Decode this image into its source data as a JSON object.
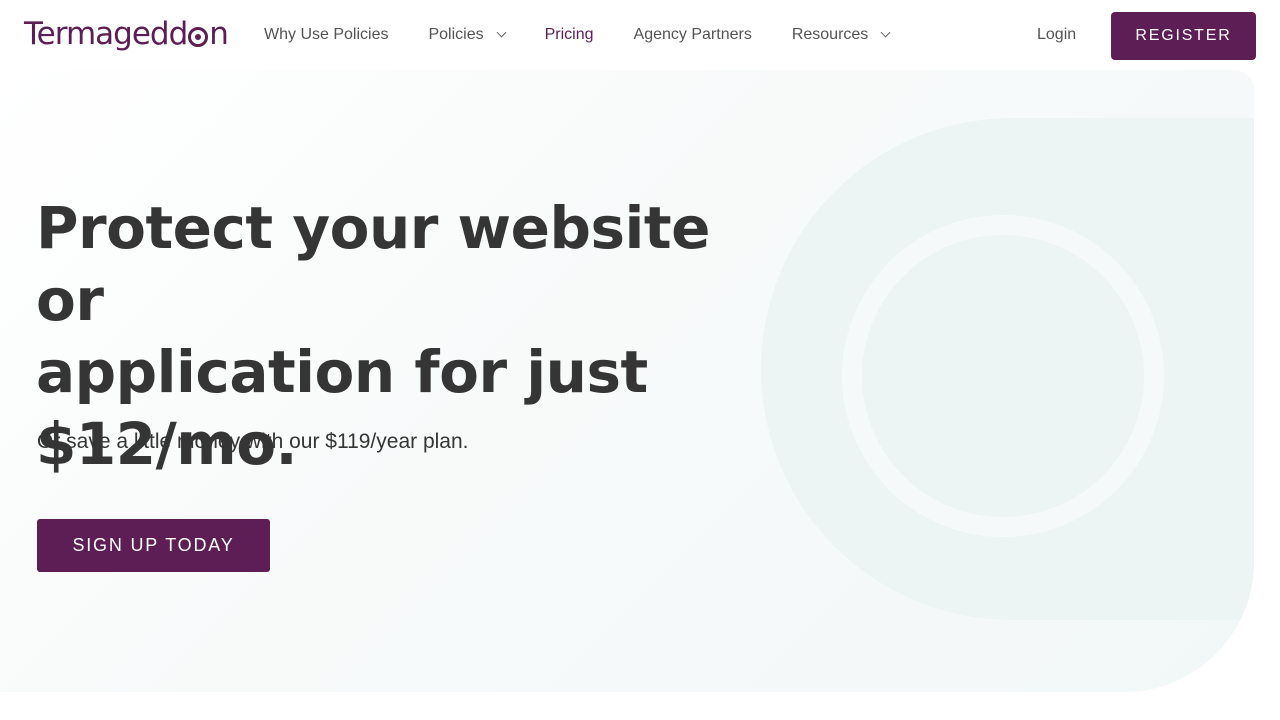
{
  "brand": {
    "name": "Termageddon",
    "name_parts": [
      "Termagedd",
      "n"
    ],
    "color": "#5c1e55"
  },
  "nav": {
    "items": [
      {
        "label": "Why Use Policies",
        "has_dropdown": false,
        "active": false
      },
      {
        "label": "Policies",
        "has_dropdown": true,
        "active": false
      },
      {
        "label": "Pricing",
        "has_dropdown": false,
        "active": true
      },
      {
        "label": "Agency Partners",
        "has_dropdown": false,
        "active": false
      },
      {
        "label": "Resources",
        "has_dropdown": true,
        "active": false
      }
    ],
    "login_label": "Login",
    "register_label": "REGISTER"
  },
  "hero": {
    "headline_lines": [
      "Protect your website or",
      "application for just",
      "$12/mo."
    ],
    "subtext": "Or save a little money with our $119/year plan.",
    "cta_label": "SIGN UP TODAY"
  },
  "colors": {
    "accent": "#5c1e55",
    "text": "#353535",
    "nav_text": "#545454",
    "hero_bg": "#f2f7f7",
    "decoration": "#edf4f4"
  },
  "icons": {
    "dropdown": "chevron-down-icon"
  }
}
